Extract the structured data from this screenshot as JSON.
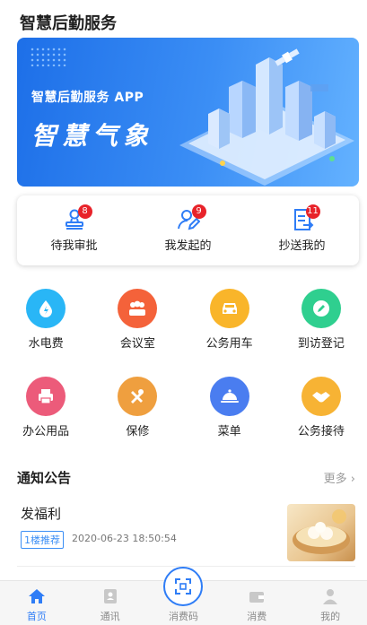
{
  "header": {
    "title": "智慧后勤服务"
  },
  "banner": {
    "subtitle": "智慧后勤服务 APP",
    "main": "智慧气象"
  },
  "approvals": [
    {
      "label": "待我审批",
      "badge": "8",
      "icon": "stamp-icon"
    },
    {
      "label": "我发起的",
      "badge": "9",
      "icon": "user-edit-icon"
    },
    {
      "label": "抄送我的",
      "badge": "11",
      "icon": "document-forward-icon"
    }
  ],
  "grid": [
    {
      "label": "水电费",
      "icon": "water-drop-icon",
      "color": "#29b6f6"
    },
    {
      "label": "会议室",
      "icon": "meeting-icon",
      "color": "#f4623a"
    },
    {
      "label": "公务用车",
      "icon": "car-icon",
      "color": "#f9b52a"
    },
    {
      "label": "到访登记",
      "icon": "pen-icon",
      "color": "#2fcf8f"
    },
    {
      "label": "办公用品",
      "icon": "printer-icon",
      "color": "#ec5b7a"
    },
    {
      "label": "保修",
      "icon": "tools-icon",
      "color": "#ef9f3f"
    },
    {
      "label": "菜单",
      "icon": "cloche-icon",
      "color": "#4a7df0"
    },
    {
      "label": "公务接待",
      "icon": "handshake-icon",
      "color": "#f7b334"
    }
  ],
  "notice": {
    "title": "通知公告",
    "more": "更多",
    "items": [
      {
        "title": "发福利",
        "tag": "1楼推荐",
        "time": "2020-06-23 18:50:54"
      }
    ]
  },
  "tabbar": [
    {
      "label": "首页",
      "icon": "home-icon",
      "active": true
    },
    {
      "label": "通讯",
      "icon": "contacts-icon"
    },
    {
      "label": "消费码",
      "icon": "scan-icon"
    },
    {
      "label": "消费",
      "icon": "wallet-icon"
    },
    {
      "label": "我的",
      "icon": "user-icon"
    }
  ],
  "colors": {
    "accent": "#2f7df6",
    "badge": "#e8232a"
  }
}
